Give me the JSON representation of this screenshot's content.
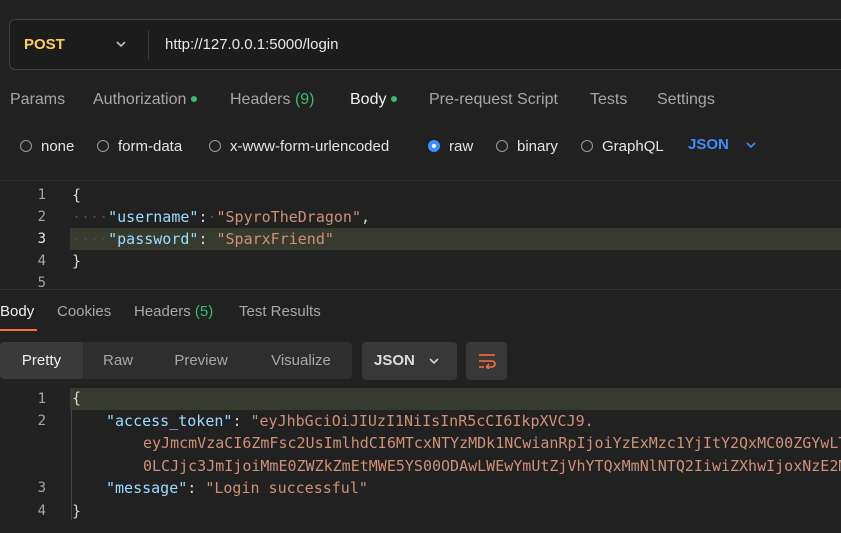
{
  "request": {
    "method": "POST",
    "url": "http://127.0.0.1:5000/login"
  },
  "request_tabs": {
    "params": "Params",
    "authorization": "Authorization",
    "headers": "Headers",
    "headers_count": "(9)",
    "body": "Body",
    "pre_request": "Pre-request Script",
    "tests": "Tests",
    "settings": "Settings"
  },
  "body_types": {
    "none": "none",
    "form_data": "form-data",
    "urlencoded": "x-www-form-urlencoded",
    "raw": "raw",
    "binary": "binary",
    "graphql": "GraphQL",
    "selected": "raw",
    "language": "JSON"
  },
  "request_body": {
    "line_numbers": [
      "1",
      "2",
      "3",
      "4",
      "5"
    ],
    "open_brace": "{",
    "close_brace": "}",
    "username_key": "\"username\"",
    "username_value": "\"SpyroTheDragon\"",
    "password_key": "\"password\"",
    "password_value": "\"SparxFriend\"",
    "colon": ":",
    "comma": ","
  },
  "response_tabs": {
    "body": "Body",
    "cookies": "Cookies",
    "headers": "Headers",
    "headers_count": "(5)",
    "test_results": "Test Results"
  },
  "response_toolbar": {
    "pretty": "Pretty",
    "raw": "Raw",
    "preview": "Preview",
    "visualize": "Visualize",
    "format": "JSON"
  },
  "response_body": {
    "line_numbers": [
      "1",
      "2",
      "3",
      "4"
    ],
    "open_brace": "{",
    "close_brace": "}",
    "token_key": "\"access_token\"",
    "token_line1": "\"eyJhbGciOiJIUzI1NiIsInR5cCI6IkpXVCJ9.",
    "token_line2": "eyJmcmVzaCI6ZmFsc2UsImlhdCI6MTcxNTYzMDk1NCwianRpIjoiYzExMzc1YjItY2QxMC00ZGYwLT",
    "token_line3": "0LCJjc3JmIjoiMmE0ZWZkZmEtMWE5YS00ODAwLWEwYmUtZjVhYTQxMmNlNTQ2IiwiZXhwIjoxNzE2M",
    "message_key": "\"message\"",
    "message_value": "\"Login successful\"",
    "colon": ":",
    "comma": ","
  },
  "colors": {
    "accent": "#ff6c37",
    "method": "#ffcd4f",
    "link": "#3c8eff",
    "success": "#3bba72",
    "json_key": "#9cdcfe",
    "json_string": "#ce9178"
  },
  "icons": {
    "method_dropdown": "chevron-down-icon",
    "language_dropdown": "chevron-down-icon",
    "format_dropdown": "chevron-down-icon",
    "wrap": "text-wrap-icon"
  }
}
